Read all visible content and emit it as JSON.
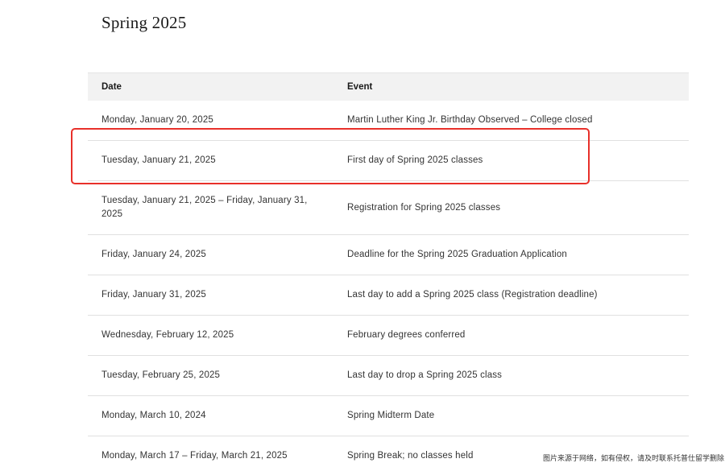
{
  "page": {
    "title": "Spring 2025"
  },
  "table": {
    "headers": {
      "date": "Date",
      "event": "Event"
    },
    "rows": [
      {
        "date": "Monday, January 20, 2025",
        "event": "Martin Luther King Jr. Birthday Observed – College closed"
      },
      {
        "date": "Tuesday, January 21, 2025",
        "event": "First day of Spring 2025 classes"
      },
      {
        "date": "Tuesday, January 21, 2025 – Friday, January 31, 2025",
        "event": "Registration for Spring 2025 classes"
      },
      {
        "date": "Friday, January 24, 2025",
        "event": "Deadline for the Spring 2025 Graduation Application"
      },
      {
        "date": "Friday, January 31, 2025",
        "event": "Last day to add a Spring 2025 class (Registration deadline)"
      },
      {
        "date": "Wednesday, February 12, 2025",
        "event": "February degrees conferred"
      },
      {
        "date": "Tuesday, February 25, 2025",
        "event": "Last day to drop a Spring 2025 class"
      },
      {
        "date": "Monday, March 10, 2024",
        "event": "Spring Midterm Date"
      },
      {
        "date": "Monday, March 17 – Friday, March 21, 2025",
        "event": "Spring Break; no classes held"
      }
    ]
  },
  "annotation": {
    "highlight_color": "#e8302a"
  },
  "watermark": {
    "text": "图片来源于网络，如有侵权，请及时联系托普仕留学删除"
  }
}
